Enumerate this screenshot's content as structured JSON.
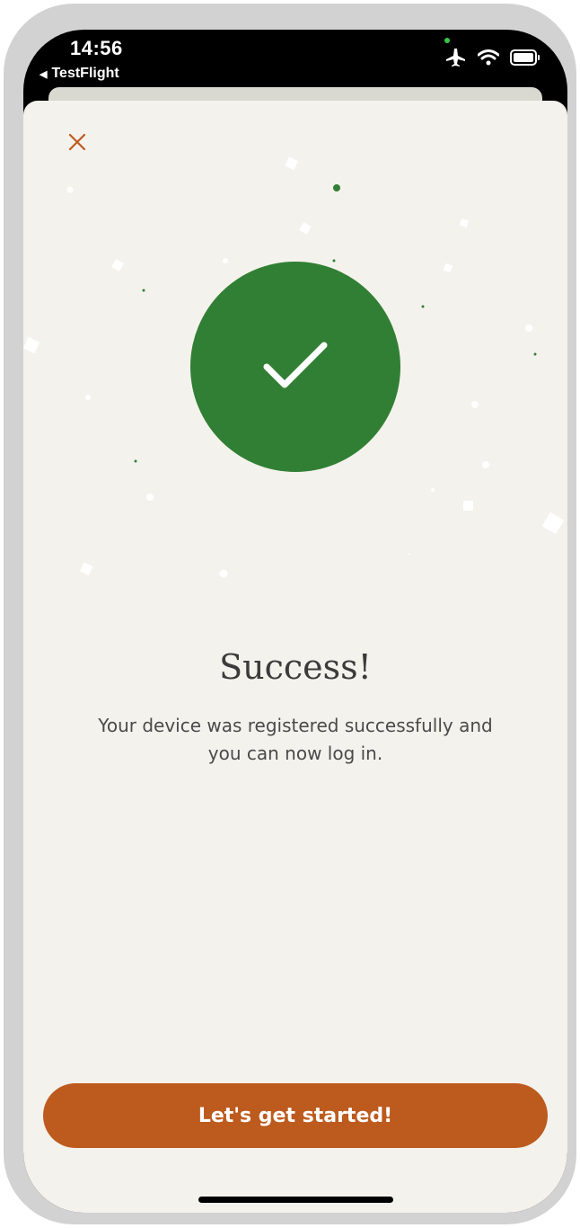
{
  "status_bar": {
    "time": "14:56",
    "back_app": "TestFlight",
    "icons": [
      "airplane-icon",
      "wifi-icon",
      "battery-icon"
    ]
  },
  "dialog": {
    "close_icon": "close-icon",
    "success_icon": "checkmark-icon",
    "title": "Success!",
    "message": "Your device was registered successfully and you can now log in.",
    "button_label": "Let's get started!"
  },
  "colors": {
    "accent": "#bd5a1e",
    "success": "#317f34",
    "background": "#f4f2ec"
  }
}
